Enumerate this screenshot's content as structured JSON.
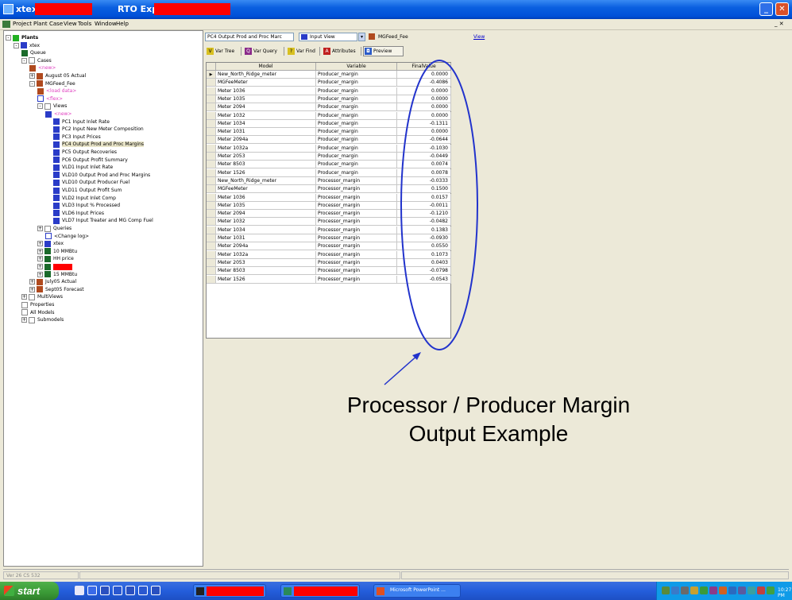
{
  "window": {
    "title_prefix": "xtex_",
    "title_app": "RTO Explorer -"
  },
  "menu": [
    "Project",
    "Plant",
    "Case",
    "View",
    "Tools",
    "Window",
    "Help"
  ],
  "tree": [
    {
      "label": "Plants",
      "bold": true,
      "icon": "green",
      "exp": "-"
    },
    {
      "label": "xtex",
      "icon": "blue",
      "exp": "-"
    },
    {
      "label": "Queue",
      "icon": "dkgreen"
    },
    {
      "label": "Cases",
      "icon": "folder",
      "exp": "-"
    },
    {
      "label": "<new>",
      "icon": "brown",
      "pink": true
    },
    {
      "label": "August 05 Actual",
      "icon": "brown",
      "exp": "+"
    },
    {
      "label": "MGFeed_Fee",
      "icon": "brown",
      "exp": "-"
    },
    {
      "label": "<load data>",
      "icon": "brown",
      "pink": true
    },
    {
      "label": "<flex>",
      "icon": "doc",
      "pink": true
    },
    {
      "label": "Views",
      "icon": "folder",
      "exp": "-"
    },
    {
      "label": "<new>",
      "icon": "blue",
      "pink": true
    },
    {
      "label": "PC1 Input Inlet Rate",
      "icon": "blue"
    },
    {
      "label": "PC2 Input New Meter Composition",
      "icon": "blue"
    },
    {
      "label": "PC3 Input Prices",
      "icon": "blue"
    },
    {
      "label": "PC4 Output Prod and Proc Margins",
      "icon": "blue",
      "selected": true
    },
    {
      "label": "PC5 Output Recoveries",
      "icon": "blue"
    },
    {
      "label": "PC6 Output Profit Summary",
      "icon": "blue"
    },
    {
      "label": "VLD1 Input Inlet Rate",
      "icon": "blue"
    },
    {
      "label": "VLD10 Output Prod and Proc Margins",
      "icon": "blue"
    },
    {
      "label": "VLD10 Output Producer Fuel",
      "icon": "blue"
    },
    {
      "label": "VLD11 Output Profit Sum",
      "icon": "blue"
    },
    {
      "label": "VLD2 Input Inlet Comp",
      "icon": "blue"
    },
    {
      "label": "VLD3 Input % Processed",
      "icon": "blue"
    },
    {
      "label": "VLD6 Input Prices",
      "icon": "blue"
    },
    {
      "label": "VLD7 Input Treater and MG Comp Fuel",
      "icon": "blue"
    },
    {
      "label": "Queries",
      "icon": "folder",
      "exp": "+"
    },
    {
      "label": "<Change log>",
      "icon": "doc"
    },
    {
      "label": "xtex",
      "icon": "blue",
      "exp": "+"
    },
    {
      "label": "10 MMBtu",
      "icon": "dkgreen",
      "exp": "+"
    },
    {
      "label": "HH price",
      "icon": "dkgreen",
      "exp": "+"
    },
    {
      "label": "",
      "icon": "dkgreen",
      "exp": "+",
      "redacted": true
    },
    {
      "label": "15 MMBtu",
      "icon": "dkgreen",
      "exp": "+"
    },
    {
      "label": "July05 Actual",
      "icon": "brown",
      "exp": "+"
    },
    {
      "label": "Sept05 Forecast",
      "icon": "brown",
      "exp": "+"
    },
    {
      "label": "MultiViews",
      "icon": "folder",
      "exp": "+"
    },
    {
      "label": "Properties",
      "icon": "folder"
    },
    {
      "label": "All Models",
      "icon": "folder"
    },
    {
      "label": "Submodels",
      "icon": "folder",
      "exp": "+"
    }
  ],
  "viewbar": {
    "view_combo": "PC4 Output Prod and Proc Marc",
    "type_combo": "Input View",
    "case_label": "MGFeed_Fee",
    "view_link": "View"
  },
  "toolbar": {
    "var_tree": "Var Tree",
    "var_query": "Var Query",
    "var_find": "Var Find",
    "attributes": "Attributes",
    "preview": "Preview"
  },
  "grid": {
    "headers": [
      "Model",
      "Variable",
      "FinalValue"
    ],
    "rows": [
      [
        "New_North_Ridge_meter",
        "Producer_margin",
        "0.0000"
      ],
      [
        "MGFeeMeter",
        "Producer_margin",
        "-0.4086"
      ],
      [
        "Meter 1036",
        "Producer_margin",
        "0.0000"
      ],
      [
        "Meter 1035",
        "Producer_margin",
        "0.0000"
      ],
      [
        "Meter 2094",
        "Producer_margin",
        "0.0000"
      ],
      [
        "Meter 1032",
        "Producer_margin",
        "0.0000"
      ],
      [
        "Meter 1034",
        "Producer_margin",
        "-0.1311"
      ],
      [
        "Meter 1031",
        "Producer_margin",
        "0.0000"
      ],
      [
        "Meter 2094a",
        "Producer_margin",
        "-0.0644"
      ],
      [
        "Meter 1032a",
        "Producer_margin",
        "-0.1030"
      ],
      [
        "Meter 2053",
        "Producer_margin",
        "-0.0449"
      ],
      [
        "Meter 8503",
        "Producer_margin",
        "0.0074"
      ],
      [
        "Meter 1526",
        "Producer_margin",
        "0.0078"
      ],
      [
        "New_North_Ridge_meter",
        "Processor_margin",
        "-0.0333"
      ],
      [
        "MGFeeMeter",
        "Processor_margin",
        "0.1500"
      ],
      [
        "Meter 1036",
        "Processor_margin",
        "0.0157"
      ],
      [
        "Meter 1035",
        "Processor_margin",
        "-0.0011"
      ],
      [
        "Meter 2094",
        "Processor_margin",
        "-0.1210"
      ],
      [
        "Meter 1032",
        "Processor_margin",
        "-0.0482"
      ],
      [
        "Meter 1034",
        "Processor_margin",
        "0.1383"
      ],
      [
        "Meter 1031",
        "Processor_margin",
        "-0.0930"
      ],
      [
        "Meter 2094a",
        "Processor_margin",
        "0.0550"
      ],
      [
        "Meter 1032a",
        "Processor_margin",
        "0.1073"
      ],
      [
        "Meter 2053",
        "Processor_margin",
        "0.0403"
      ],
      [
        "Meter 8503",
        "Processor_margin",
        "-0.0798"
      ],
      [
        "Meter 1526",
        "Processor_margin",
        "-0.0543"
      ]
    ]
  },
  "annotation": {
    "line1": "Processor / Producer Margin",
    "line2": "Output Example"
  },
  "statusbar": {
    "cell1": "Ver 26 CS 532"
  },
  "taskbar": {
    "start": "start",
    "ppt_task": "Microsoft PowerPoint ..."
  },
  "colors": {
    "annotation": "#2233cc",
    "redaction": "#ff0000",
    "title_bar": "#0a5fe0"
  }
}
